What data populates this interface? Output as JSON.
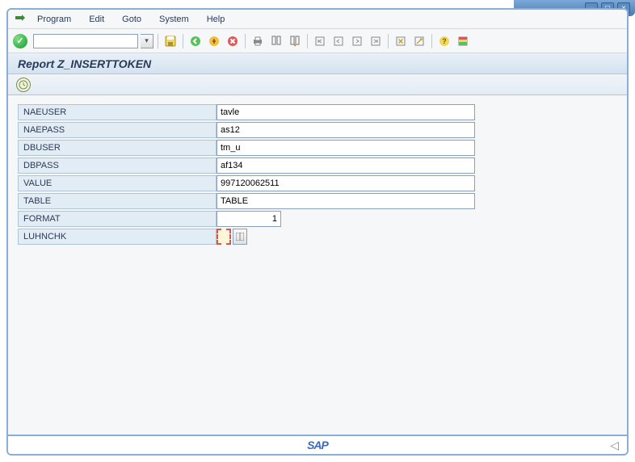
{
  "window": {
    "minimize": "–",
    "maximize": "□",
    "close": "×"
  },
  "menu": {
    "program": "Program",
    "edit": "Edit",
    "goto": "Goto",
    "system": "System",
    "help": "Help"
  },
  "toolbar": {
    "command_value": "",
    "dropdown_glyph": "▾",
    "ok": "✓"
  },
  "report": {
    "title": "Report Z_INSERTTOKEN"
  },
  "form": {
    "fields": [
      {
        "label": "NAEUSER",
        "value": "tavle"
      },
      {
        "label": "NAEPASS",
        "value": "as12"
      },
      {
        "label": "DBUSER",
        "value": "tm_u"
      },
      {
        "label": "DBPASS",
        "value": "af134"
      },
      {
        "label": "VALUE",
        "value": "997120062511"
      },
      {
        "label": "TABLE",
        "value": "TABLE"
      }
    ],
    "format": {
      "label": "FORMAT",
      "value": "1"
    },
    "luhn": {
      "label": "LUHNCHK",
      "value": ""
    }
  },
  "status": {
    "sap": "SAP",
    "back": "◁"
  }
}
